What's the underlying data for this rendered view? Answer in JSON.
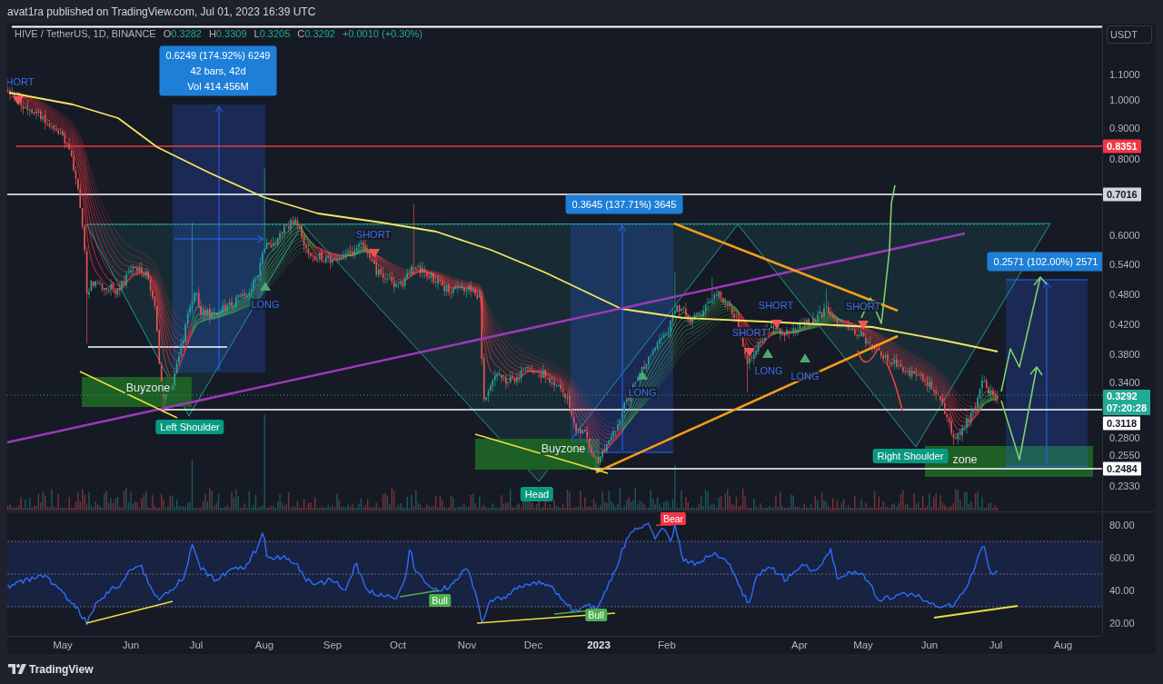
{
  "header": {
    "publisher_line": "avat1ra published on TradingView.com, Jul 01, 2023 16:39 UTC"
  },
  "legend": {
    "symbol": "HIVE / TetherUS, 1D, BINANCE",
    "ohlc": [
      {
        "label": "O",
        "value": "0.3282"
      },
      {
        "label": "H",
        "value": "0.3309"
      },
      {
        "label": "L",
        "value": "0.3205"
      },
      {
        "label": "C",
        "value": "0.3292"
      }
    ],
    "change": "+0.0010 (+0.30%)"
  },
  "measurements": [
    {
      "lines": [
        "0.6249 (174.92%) 6249",
        "42 bars, 42d",
        "Vol 414.456M"
      ]
    },
    {
      "lines": [
        "0.3645 (137.71%) 3645"
      ]
    },
    {
      "lines": [
        "0.2571 (102.00%) 2571"
      ]
    }
  ],
  "signal_labels": [
    "HORT",
    "SHORT",
    "LONG",
    "SHORT",
    "SHORT",
    "SHORT",
    "LONG",
    "LONG",
    "LONG"
  ],
  "zone_labels": [
    "Buyzone",
    "Buyzone",
    "zone"
  ],
  "pattern_labels": [
    "Left Shoulder",
    "Head",
    "Right Shoulder"
  ],
  "price_axis": {
    "currency": "USDT",
    "labels": [
      "1.1000",
      "1.0000",
      "0.9000",
      "0.8000",
      "0.6000",
      "0.5400",
      "0.4800",
      "0.4200",
      "0.3800",
      "0.3400",
      "0.2800",
      "0.2550",
      "0.2330"
    ],
    "tags": [
      {
        "text": "0.8351",
        "color": "#f23645"
      },
      {
        "text": "0.7016",
        "color": "#d1d4dc"
      },
      {
        "text": "0.3292",
        "subtext": "07:20:28",
        "color": "#22ab94"
      },
      {
        "text": "0.3118",
        "color": "#ffffff"
      },
      {
        "text": "0.2484",
        "color": "#ffffff"
      }
    ]
  },
  "rsi": {
    "axis_labels": [
      "80.00",
      "60.00",
      "40.00",
      "20.00"
    ],
    "divergences": [
      {
        "text": "Bull",
        "kind": "bull"
      },
      {
        "text": "Bull",
        "kind": "bull"
      },
      {
        "text": "Bear",
        "kind": "bear"
      }
    ]
  },
  "time_axis": {
    "labels": [
      {
        "text": "May",
        "kind": "month"
      },
      {
        "text": "Jun",
        "kind": "month"
      },
      {
        "text": "Jul",
        "kind": "month"
      },
      {
        "text": "Aug",
        "kind": "month"
      },
      {
        "text": "Sep",
        "kind": "month"
      },
      {
        "text": "Oct",
        "kind": "month"
      },
      {
        "text": "Nov",
        "kind": "month"
      },
      {
        "text": "Dec",
        "kind": "month"
      },
      {
        "text": "2023",
        "kind": "year"
      },
      {
        "text": "Feb",
        "kind": "month"
      },
      {
        "text": "Apr",
        "kind": "month"
      },
      {
        "text": "May",
        "kind": "month"
      },
      {
        "text": "Jun",
        "kind": "month"
      },
      {
        "text": "Jul",
        "kind": "month"
      },
      {
        "text": "Aug",
        "kind": "month"
      }
    ]
  },
  "footer": {
    "brand": "TradingView"
  }
}
